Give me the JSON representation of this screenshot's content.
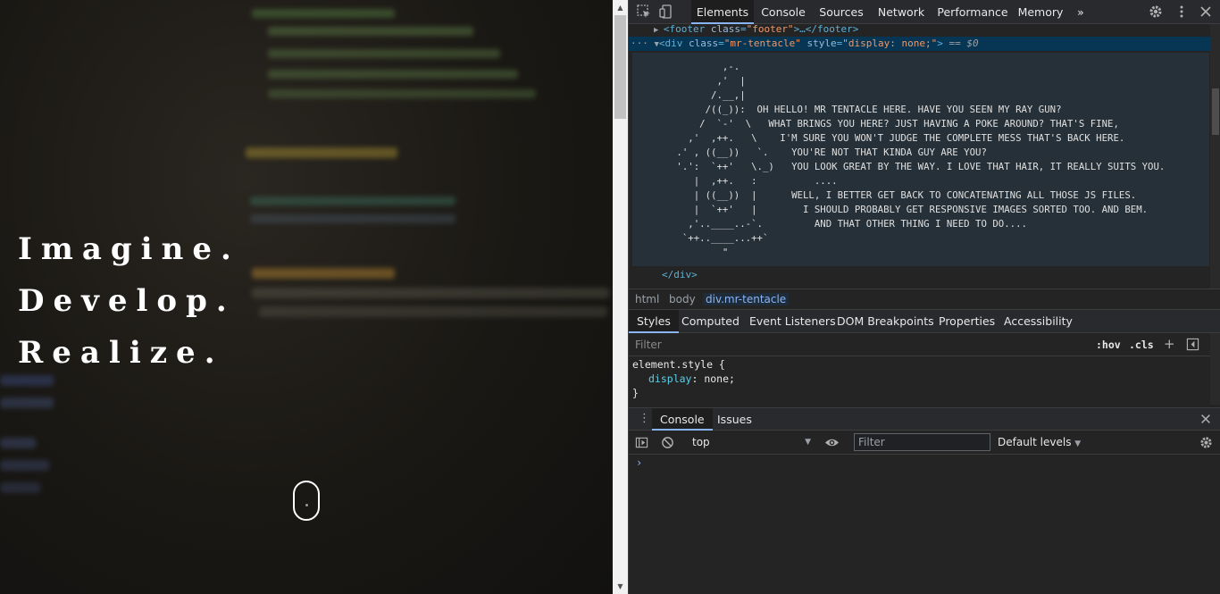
{
  "page": {
    "hero_lines": [
      "Imagine.",
      "Develop.",
      "Realize."
    ]
  },
  "devtools": {
    "tabs": [
      "Elements",
      "Console",
      "Sources",
      "Network",
      "Performance",
      "Memory"
    ],
    "more_tabs": "»",
    "dom": {
      "footer_open": "<footer",
      "footer_attr": "class",
      "footer_val": "\"footer\"",
      "footer_close": ">…</footer>",
      "div_open": "<div",
      "div_attr1": "class",
      "div_val1": "\"mr-tentacle\"",
      "div_attr2": "style",
      "div_val2": "\"display: none;\"",
      "div_end": ">",
      "selected_marker": "== $0",
      "ascii_quote": "\"",
      "ascii_art": "         ,-.\n        ,'  |\n       /.__,|\n      /((_)):  OH HELLO! MR TENTACLE HERE. HAVE YOU SEEN MY RAY GUN?\n     /  `-'  \\   WHAT BRINGS YOU HERE? JUST HAVING A POKE AROUND? THAT'S FINE,\n   ,'  ,++.   \\    I'M SURE YOU WON'T JUDGE THE COMPLETE MESS THAT'S BACK HERE.\n .' , ((__))   `.    YOU'RE NOT THAT KINDA GUY ARE YOU?\n '.':  `++'   \\._)   YOU LOOK GREAT BY THE WAY. I LOVE THAT HAIR, IT REALLY SUITS YOU.\n    |  ,++.   :          ....\n    | ((__))  |      WELL, I BETTER GET BACK TO CONCATENATING ALL THOSE JS FILES.\n    |  `++'   |        I SHOULD PROBABLY GET RESPONSIVE IMAGES SORTED TOO. AND BEM.\n   ,'..____..-`.         AND THAT OTHER THING I NEED TO DO....\n  `++..____...++`\n         \"",
      "div_closing": "</div>"
    },
    "breadcrumbs": [
      "html",
      "body",
      "div.mr-tentacle"
    ],
    "style_tabs": [
      "Styles",
      "Computed",
      "Event Listeners",
      "DOM Breakpoints",
      "Properties",
      "Accessibility"
    ],
    "filter_placeholder": "Filter",
    "hov": ":hov",
    "cls": ".cls",
    "element_style": {
      "selector": "element.style {",
      "prop": "display",
      "value": ": none;",
      "close": "}"
    },
    "drawer": {
      "tabs": [
        "Console",
        "Issues"
      ],
      "context": "top",
      "filter_placeholder": "Filter",
      "levels": "Default levels",
      "prompt": "›"
    }
  },
  "colors": {
    "accent": "#8ab4f8",
    "tag": "#5db0d7",
    "attr_value": "#f29766",
    "selected_row": "#073655"
  }
}
